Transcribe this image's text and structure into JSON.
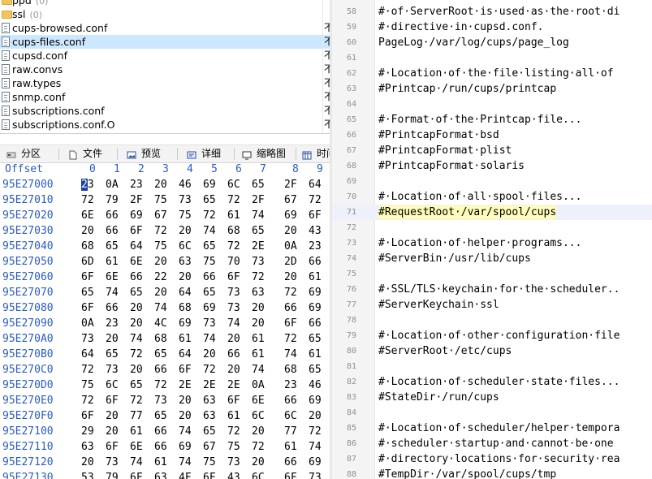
{
  "file_list": [
    {
      "name": "ppd",
      "count": "(0)",
      "kind": "folder",
      "type_char": ""
    },
    {
      "name": "ssl",
      "count": "(0)",
      "kind": "folder",
      "type_char": ""
    },
    {
      "name": "cups-browsed.conf",
      "count": "",
      "kind": "file",
      "type_char": "不"
    },
    {
      "name": "cups-files.conf",
      "count": "",
      "kind": "file",
      "type_char": "不",
      "selected": true
    },
    {
      "name": "cupsd.conf",
      "count": "",
      "kind": "file",
      "type_char": "不"
    },
    {
      "name": "raw.convs",
      "count": "",
      "kind": "file",
      "type_char": "不"
    },
    {
      "name": "raw.types",
      "count": "",
      "kind": "file",
      "type_char": "不"
    },
    {
      "name": "snmp.conf",
      "count": "",
      "kind": "file",
      "type_char": "不"
    },
    {
      "name": "subscriptions.conf",
      "count": "",
      "kind": "file",
      "type_char": "不"
    },
    {
      "name": "subscriptions.conf.O",
      "count": "",
      "kind": "file",
      "type_char": "不"
    }
  ],
  "toolbar": {
    "partition": "分区",
    "file": "文件",
    "preview": "预览",
    "details": "详细",
    "thumbnail": "缩略图",
    "time": "时间"
  },
  "hex": {
    "offset_label": "Offset",
    "columns": [
      "0",
      "1",
      "2",
      "3",
      "4",
      "5",
      "6",
      "7",
      "8",
      "9"
    ],
    "rows": [
      {
        "addr": "95E27000",
        "bytes": [
          "23",
          "0A",
          "23",
          "20",
          "46",
          "69",
          "6C",
          "65",
          "2F",
          "64"
        ]
      },
      {
        "addr": "95E27010",
        "bytes": [
          "72",
          "79",
          "2F",
          "75",
          "73",
          "65",
          "72",
          "2F",
          "67",
          "72"
        ]
      },
      {
        "addr": "95E27020",
        "bytes": [
          "6E",
          "66",
          "69",
          "67",
          "75",
          "72",
          "61",
          "74",
          "69",
          "6F"
        ]
      },
      {
        "addr": "95E27030",
        "bytes": [
          "20",
          "66",
          "6F",
          "72",
          "20",
          "74",
          "68",
          "65",
          "20",
          "43"
        ]
      },
      {
        "addr": "95E27040",
        "bytes": [
          "68",
          "65",
          "64",
          "75",
          "6C",
          "65",
          "72",
          "2E",
          "0A",
          "23"
        ]
      },
      {
        "addr": "95E27050",
        "bytes": [
          "6D",
          "61",
          "6E",
          "20",
          "63",
          "75",
          "70",
          "73",
          "2D",
          "66"
        ]
      },
      {
        "addr": "95E27060",
        "bytes": [
          "6F",
          "6E",
          "66",
          "22",
          "20",
          "66",
          "6F",
          "72",
          "20",
          "61"
        ]
      },
      {
        "addr": "95E27070",
        "bytes": [
          "65",
          "74",
          "65",
          "20",
          "64",
          "65",
          "73",
          "63",
          "72",
          "69"
        ]
      },
      {
        "addr": "95E27080",
        "bytes": [
          "6F",
          "66",
          "20",
          "74",
          "68",
          "69",
          "73",
          "20",
          "66",
          "69"
        ]
      },
      {
        "addr": "95E27090",
        "bytes": [
          "0A",
          "23",
          "20",
          "4C",
          "69",
          "73",
          "74",
          "20",
          "6F",
          "66"
        ]
      },
      {
        "addr": "95E270A0",
        "bytes": [
          "73",
          "20",
          "74",
          "68",
          "61",
          "74",
          "20",
          "61",
          "72",
          "65"
        ]
      },
      {
        "addr": "95E270B0",
        "bytes": [
          "64",
          "65",
          "72",
          "65",
          "64",
          "20",
          "66",
          "61",
          "74",
          "61"
        ]
      },
      {
        "addr": "95E270C0",
        "bytes": [
          "72",
          "73",
          "20",
          "66",
          "6F",
          "72",
          "20",
          "74",
          "68",
          "65"
        ]
      },
      {
        "addr": "95E270D0",
        "bytes": [
          "75",
          "6C",
          "65",
          "72",
          "2E",
          "2E",
          "2E",
          "0A",
          "23",
          "46"
        ]
      },
      {
        "addr": "95E270E0",
        "bytes": [
          "72",
          "6F",
          "72",
          "73",
          "20",
          "63",
          "6F",
          "6E",
          "66",
          "69"
        ]
      },
      {
        "addr": "95E270F0",
        "bytes": [
          "6F",
          "20",
          "77",
          "65",
          "20",
          "63",
          "61",
          "6C",
          "6C",
          "20"
        ]
      },
      {
        "addr": "95E27100",
        "bytes": [
          "29",
          "20",
          "61",
          "66",
          "74",
          "65",
          "72",
          "20",
          "77",
          "72"
        ]
      },
      {
        "addr": "95E27110",
        "bytes": [
          "63",
          "6F",
          "6E",
          "66",
          "69",
          "67",
          "75",
          "72",
          "61",
          "74"
        ]
      },
      {
        "addr": "95E27120",
        "bytes": [
          "20",
          "73",
          "74",
          "61",
          "74",
          "75",
          "73",
          "20",
          "66",
          "69"
        ]
      },
      {
        "addr": "95E27130",
        "bytes": [
          "53",
          "79",
          "6F",
          "63",
          "4F",
          "6F",
          "43",
          "6C",
          "6F",
          "73"
        ]
      }
    ]
  },
  "code": [
    {
      "ln": "58",
      "text": "#·of·ServerRoot·is·used·as·the·root·di"
    },
    {
      "ln": "59",
      "text": "#·directive·in·cupsd.conf."
    },
    {
      "ln": "60",
      "text": "PageLog·/var/log/cups/page_log"
    },
    {
      "ln": "61",
      "text": ""
    },
    {
      "ln": "62",
      "text": "#·Location·of·the·file·listing·all·of"
    },
    {
      "ln": "63",
      "text": "#Printcap·/run/cups/printcap"
    },
    {
      "ln": "64",
      "text": ""
    },
    {
      "ln": "65",
      "text": "#·Format·of·the·Printcap·file..."
    },
    {
      "ln": "66",
      "text": "#PrintcapFormat·bsd"
    },
    {
      "ln": "67",
      "text": "#PrintcapFormat·plist"
    },
    {
      "ln": "68",
      "text": "#PrintcapFormat·solaris"
    },
    {
      "ln": "69",
      "text": ""
    },
    {
      "ln": "70",
      "text": "#·Location·of·all·spool·files..."
    },
    {
      "ln": "71",
      "text": "#RequestRoot·/var/spool/cups",
      "highlight": true
    },
    {
      "ln": "72",
      "text": ""
    },
    {
      "ln": "73",
      "text": "#·Location·of·helper·programs..."
    },
    {
      "ln": "74",
      "text": "#ServerBin·/usr/lib/cups"
    },
    {
      "ln": "75",
      "text": ""
    },
    {
      "ln": "76",
      "text": "#·SSL/TLS·keychain·for·the·scheduler.."
    },
    {
      "ln": "77",
      "text": "#ServerKeychain·ssl"
    },
    {
      "ln": "78",
      "text": ""
    },
    {
      "ln": "79",
      "text": "#·Location·of·other·configuration·file"
    },
    {
      "ln": "80",
      "text": "#ServerRoot·/etc/cups"
    },
    {
      "ln": "81",
      "text": ""
    },
    {
      "ln": "82",
      "text": "#·Location·of·scheduler·state·files..."
    },
    {
      "ln": "83",
      "text": "#StateDir·/run/cups"
    },
    {
      "ln": "84",
      "text": ""
    },
    {
      "ln": "85",
      "text": "#·Location·of·scheduler/helper·tempora"
    },
    {
      "ln": "86",
      "text": "#·scheduler·startup·and·cannot·be·one"
    },
    {
      "ln": "87",
      "text": "#·directory·locations·for·security·rea"
    },
    {
      "ln": "88",
      "text": "#TempDir·/var/spool/cups/tmp"
    }
  ]
}
